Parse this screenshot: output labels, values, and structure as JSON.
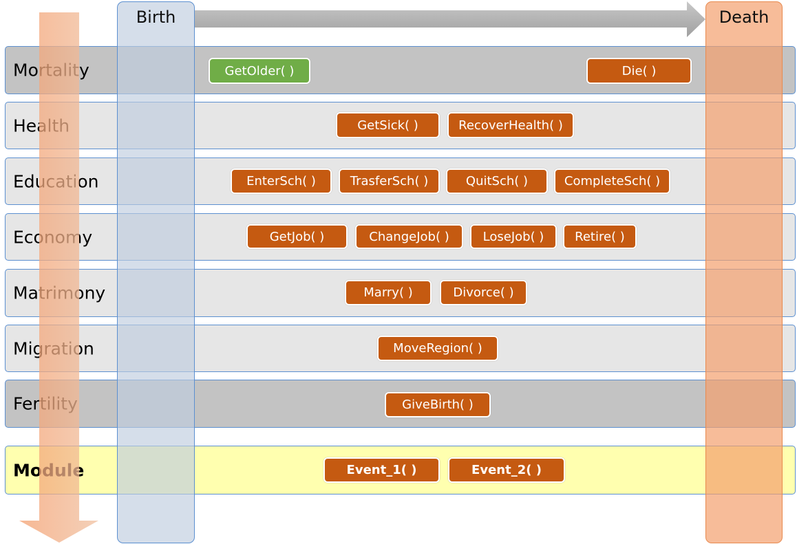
{
  "columns": {
    "birth": "Birth",
    "death": "Death"
  },
  "rows": [
    {
      "label": "Mortality",
      "events": [
        "GetOlder( )",
        "Die( )"
      ]
    },
    {
      "label": "Health",
      "events": [
        "GetSick( )",
        "RecoverHealth( )"
      ]
    },
    {
      "label": "Education",
      "events": [
        "EnterSch( )",
        "TrasferSch( )",
        "QuitSch( )",
        "CompleteSch( )"
      ]
    },
    {
      "label": "Economy",
      "events": [
        "GetJob( )",
        "ChangeJob( )",
        "LoseJob( )",
        "Retire( )"
      ]
    },
    {
      "label": "Matrimony",
      "events": [
        "Marry( )",
        "Divorce( )"
      ]
    },
    {
      "label": "Migration",
      "events": [
        "MoveRegion( )"
      ]
    },
    {
      "label": "Fertility",
      "events": [
        "GiveBirth( )"
      ]
    },
    {
      "label": "Module",
      "events": [
        "Event_1( )",
        "Event_2( )"
      ]
    }
  ],
  "colors": {
    "event": "#c55a11",
    "event_highlight": "#70ad47",
    "module_row": "#ffffaf"
  }
}
